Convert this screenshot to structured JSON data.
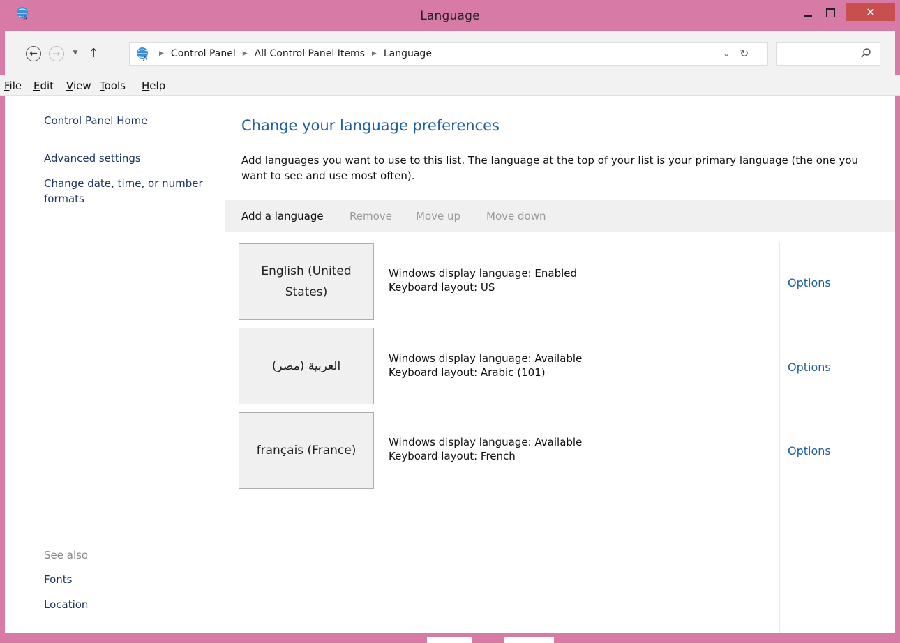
{
  "window": {
    "title": "Language"
  },
  "address_bar": {
    "breadcrumbs": [
      "Control Panel",
      "All Control Panel Items",
      "Language"
    ],
    "search_placeholder": ""
  },
  "menu": {
    "items": [
      {
        "label": "File",
        "underline": "F",
        "rest": "ile"
      },
      {
        "label": "Edit",
        "underline": "E",
        "rest": "dit"
      },
      {
        "label": "View",
        "underline": "V",
        "rest": "iew"
      },
      {
        "label": "Tools",
        "underline": "T",
        "rest": "ools"
      },
      {
        "label": "Help",
        "underline": "H",
        "rest": "elp"
      }
    ]
  },
  "sidebar": {
    "home": "Control Panel Home",
    "advanced": "Advanced settings",
    "date_formats": "Change date, time, or number formats",
    "see_also": "See also",
    "fonts": "Fonts",
    "location": "Location"
  },
  "main": {
    "title": "Change your language preferences",
    "description": "Add languages you want to use to this list. The language at the top of your list is your primary language (the one you want to see and use most often).",
    "toolbar": {
      "add": "Add a language",
      "remove": "Remove",
      "move_up": "Move up",
      "move_down": "Move down"
    },
    "languages": [
      {
        "name": "English (United States)",
        "display": "Windows display language: Enabled",
        "keyboard": "Keyboard layout: US",
        "options": "Options"
      },
      {
        "name": "العربية (مصر)",
        "display": "Windows display language: Available",
        "keyboard": "Keyboard layout: Arabic (101)",
        "options": "Options"
      },
      {
        "name": "français (France)",
        "display": "Windows display language: Available",
        "keyboard": "Keyboard layout: French",
        "options": "Options"
      }
    ]
  },
  "colors": {
    "frame": "#d77aa6",
    "close_button": "#c7504f",
    "link": "#1e5fa0",
    "sidebar_link": "#1d3560"
  },
  "icons": {
    "app": "language-globe-icon",
    "search": "search-icon",
    "refresh": "refresh-icon"
  }
}
